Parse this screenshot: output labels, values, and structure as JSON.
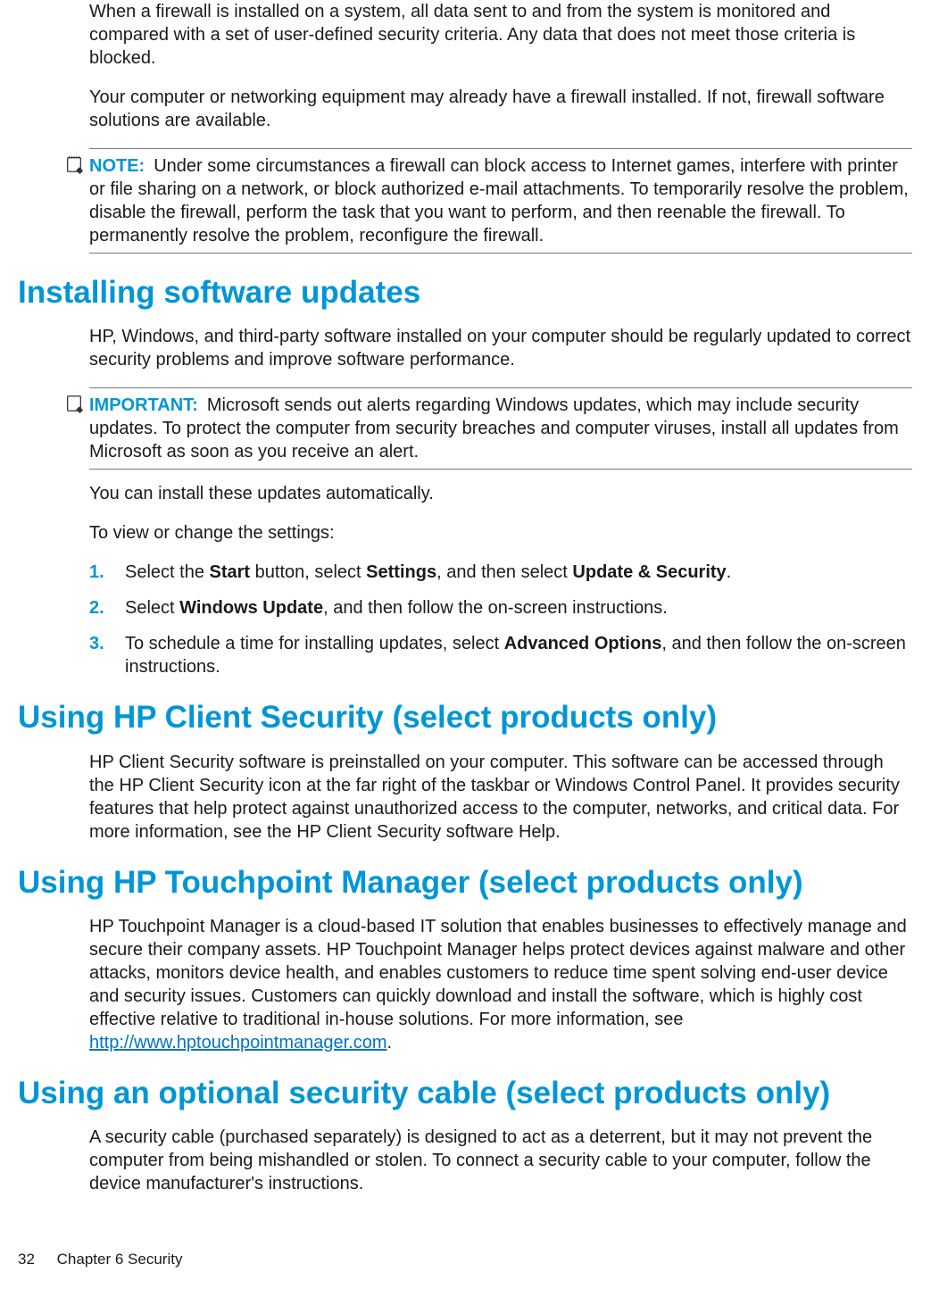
{
  "intro": {
    "p1": "When a firewall is installed on a system, all data sent to and from the system is monitored and compared with a set of user-defined security criteria. Any data that does not meet those criteria is blocked.",
    "p2": "Your computer or networking equipment may already have a firewall installed. If not, firewall software solutions are available."
  },
  "note": {
    "label": "NOTE:",
    "text": "Under some circumstances a firewall can block access to Internet games, interfere with printer or file sharing on a network, or block authorized e-mail attachments. To temporarily resolve the problem, disable the firewall, perform the task that you want to perform, and then reenable the firewall. To permanently resolve the problem, reconfigure the firewall."
  },
  "sec_updates": {
    "heading": "Installing software updates",
    "p1": "HP, Windows, and third-party software installed on your computer should be regularly updated to correct security problems and improve software performance.",
    "important": {
      "label": "IMPORTANT:",
      "text": "Microsoft sends out alerts regarding Windows updates, which may include security updates. To protect the computer from security breaches and computer viruses, install all updates from Microsoft as soon as you receive an alert."
    },
    "p2": "You can install these updates automatically.",
    "p3": "To view or change the settings:",
    "steps": {
      "s1_pre": "Select the ",
      "s1_b1": "Start",
      "s1_mid1": " button, select ",
      "s1_b2": "Settings",
      "s1_mid2": ", and then select ",
      "s1_b3": "Update & Security",
      "s1_post": ".",
      "s2_pre": "Select ",
      "s2_b1": "Windows Update",
      "s2_post": ", and then follow the on-screen instructions.",
      "s3_pre": "To schedule a time for installing updates, select ",
      "s3_b1": "Advanced Options",
      "s3_post": ", and then follow the on-screen instructions."
    }
  },
  "sec_client": {
    "heading": "Using HP Client Security (select products only)",
    "p1": "HP Client Security software is preinstalled on your computer. This software can be accessed through the HP Client Security icon at the far right of the taskbar or Windows Control Panel. It provides security features that help protect against unauthorized access to the computer, networks, and critical data. For more information, see the HP Client Security software Help."
  },
  "sec_touchpoint": {
    "heading": "Using HP Touchpoint Manager (select products only)",
    "p1_pre": "HP Touchpoint Manager is a cloud-based IT solution that enables businesses to effectively manage and secure their company assets. HP Touchpoint Manager helps protect devices against malware and other attacks, monitors device health, and enables customers to reduce time spent solving end-user device and security issues. Customers can quickly download and install the software, which is highly cost effective relative to traditional in-house solutions. For more information, see ",
    "link": "http://www.hptouchpointmanager.com",
    "p1_post": "."
  },
  "sec_cable": {
    "heading": "Using an optional security cable (select products only)",
    "p1": "A security cable (purchased separately) is designed to act as a deterrent, but it may not prevent the computer from being mishandled or stolen. To connect a security cable to your computer, follow the device manufacturer's instructions."
  },
  "footer": {
    "page": "32",
    "chapter": "Chapter 6   Security"
  }
}
